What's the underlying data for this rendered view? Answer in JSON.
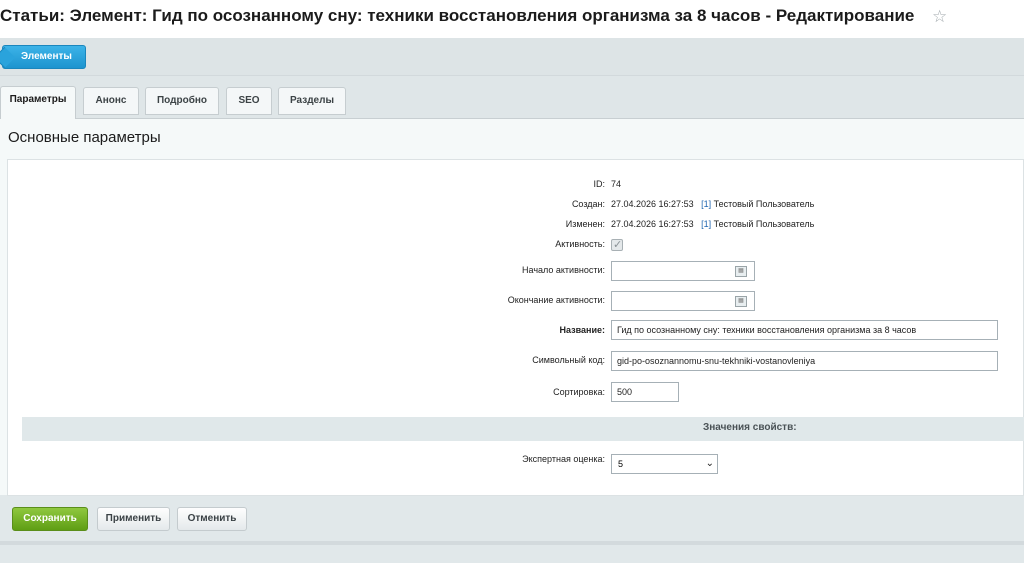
{
  "header": {
    "title": "Статьи: Элемент: Гид по осознанному сну: техники восстановления организма за 8 часов - Редактирование",
    "star": "☆"
  },
  "nav": {
    "back_label": "Элементы"
  },
  "tabs": [
    {
      "label": "Параметры",
      "active": true
    },
    {
      "label": "Анонс",
      "active": false
    },
    {
      "label": "Подробно",
      "active": false
    },
    {
      "label": "SEO",
      "active": false
    },
    {
      "label": "Разделы",
      "active": false
    }
  ],
  "section": {
    "title": "Основные параметры"
  },
  "form": {
    "id_label": "ID:",
    "id_value": "74",
    "created_label": "Создан:",
    "created_value": "27.04.2026 16:27:53",
    "created_link": "[1]",
    "created_user": "Тестовый Пользователь",
    "modified_label": "Изменен:",
    "modified_value": "27.04.2026 16:27:53",
    "modified_link": "[1]",
    "modified_user": "Тестовый Пользователь",
    "active_label": "Активность:",
    "active_checked": true,
    "active_from_label": "Начало активности:",
    "active_from_value": "",
    "active_to_label": "Окончание активности:",
    "active_to_value": "",
    "name_label": "Название:",
    "name_value": "Гид по осознанному сну: техники восстановления организма за 8 часов",
    "code_label": "Символьный код:",
    "code_value": "gid-po-osoznannomu-snu-tekhniki-vostanovleniya",
    "sort_label": "Сортировка:",
    "sort_value": "500",
    "props_title": "Значения свойств:",
    "rating_label": "Экспертная оценка:",
    "rating_value": "5"
  },
  "buttons": {
    "save": "Сохранить",
    "apply": "Применить",
    "cancel": "Отменить"
  },
  "colors": {
    "accent_blue": "#1d94cf",
    "save_green": "#5f9e14",
    "link": "#2066b0"
  }
}
